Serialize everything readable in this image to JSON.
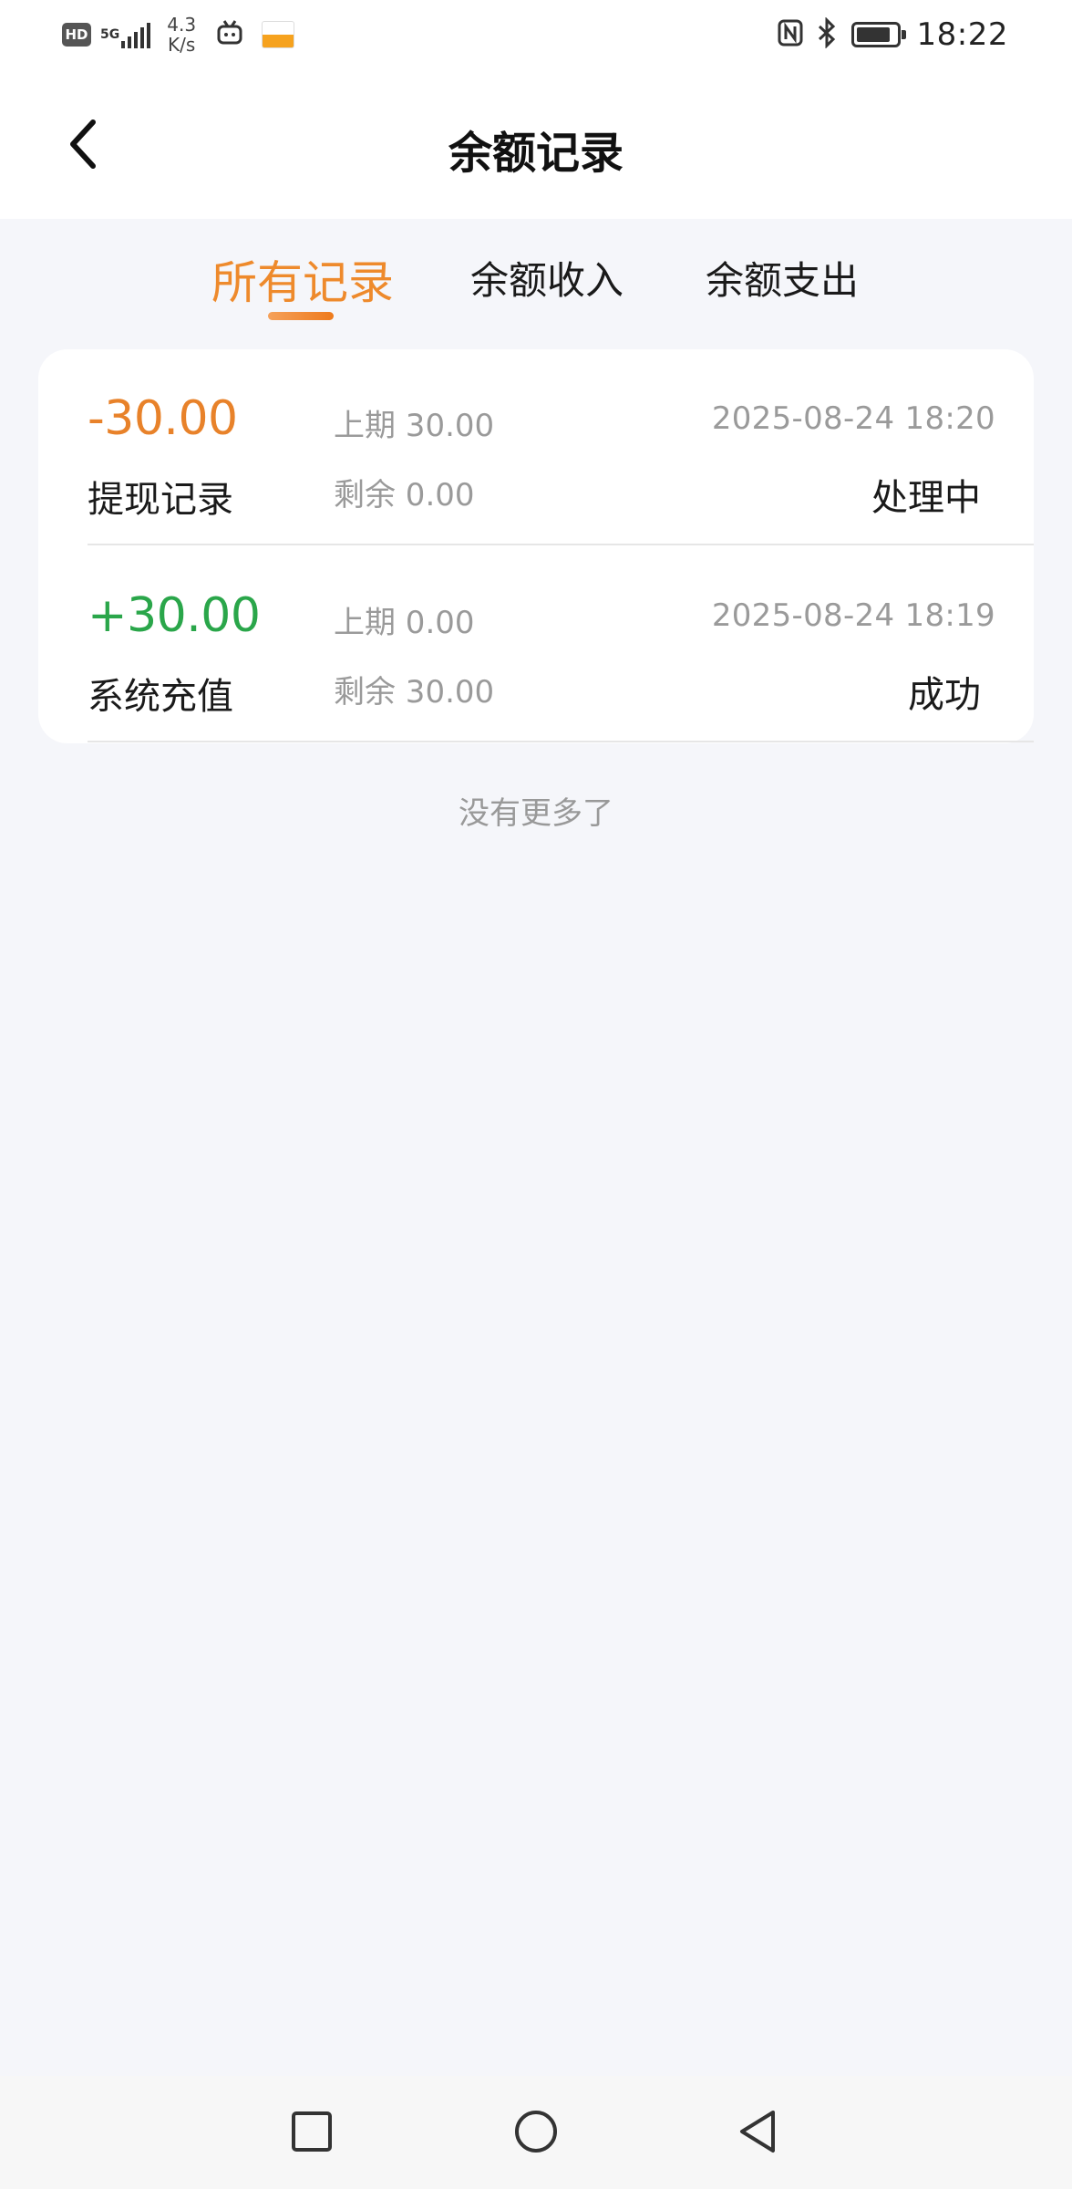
{
  "status_bar": {
    "hd_badge": "HD",
    "network_type": "5G",
    "net_speed_value": "4.3",
    "net_speed_unit": "K/s",
    "time": "18:22",
    "icons": [
      "hd-icon",
      "signal-icon",
      "tv-icon",
      "app-notification-icon",
      "nfc-icon",
      "bluetooth-icon",
      "battery-icon"
    ]
  },
  "header": {
    "title": "余额记录",
    "back_icon": "chevron-left-icon"
  },
  "tabs": [
    {
      "label": "所有记录",
      "active": true
    },
    {
      "label": "余额收入",
      "active": false
    },
    {
      "label": "余额支出",
      "active": false
    }
  ],
  "records": [
    {
      "amount": "-30.00",
      "type": "提现记录",
      "previous": "上期 30.00",
      "remaining": "剩余 0.00",
      "time": "2025-08-24 18:20",
      "status": "处理中"
    },
    {
      "amount": "+30.00",
      "type": "系统充值",
      "previous": "上期 0.00",
      "remaining": "剩余 30.00",
      "time": "2025-08-24 18:19",
      "status": "成功"
    }
  ],
  "footer_text": "没有更多了",
  "colors": {
    "accent": "#ee8a2c",
    "negative": "#e8822a",
    "positive": "#2aa64a",
    "background": "#f5f6fa"
  },
  "nav_bar": {
    "buttons": [
      "recent-apps-icon",
      "home-icon",
      "back-icon"
    ]
  }
}
